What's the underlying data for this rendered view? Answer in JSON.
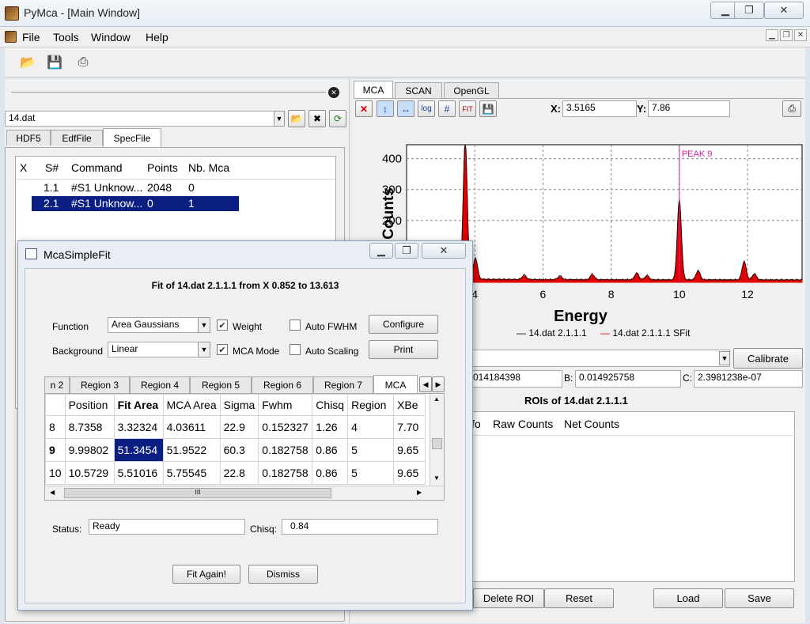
{
  "window": {
    "title": "PyMca - [Main Window]"
  },
  "menu": [
    "File",
    "Tools",
    "Window",
    "Help"
  ],
  "source": {
    "file": "14.dat",
    "tabs": [
      "HDF5",
      "EdfFile",
      "SpecFile"
    ],
    "columns": [
      "X",
      "S#",
      "Command",
      "Points",
      "Nb. Mca"
    ],
    "rows": [
      {
        "sn": "1.1",
        "command": "#S1 Unknow...",
        "points": "2048",
        "nbmca": "0"
      },
      {
        "sn": "2.1",
        "command": "#S1 Unknow...",
        "points": "0",
        "nbmca": "1"
      }
    ]
  },
  "plot": {
    "tabs": [
      "MCA",
      "SCAN",
      "OpenGL"
    ],
    "x_label_prefix": "X:",
    "x_value": "3.5165",
    "y_label_prefix": "Y:",
    "y_value": "7.86",
    "legend": [
      "— 14.dat 2.1.1.1",
      "— 14.dat 2.1.1.1 SFit"
    ],
    "colors": {
      "data": "#000000",
      "fit": "#e00000",
      "marker": "#d020a0"
    }
  },
  "chart_data": {
    "type": "line",
    "xlabel": "Energy",
    "ylabel": "Counts",
    "x_ticks": [
      4,
      6,
      8,
      10,
      12
    ],
    "y_ticks": [
      200,
      300,
      400
    ],
    "xlim": [
      2.0,
      13.6
    ],
    "ylim": [
      0,
      445
    ],
    "marker_label": "PEAK 9",
    "marker_x": 10.0,
    "series": [
      {
        "name": "14.dat 2.1.1.1",
        "peaks": [
          [
            3.5,
            60
          ],
          [
            3.72,
            445
          ],
          [
            4.02,
            70
          ],
          [
            5.45,
            15
          ],
          [
            6.5,
            12
          ],
          [
            7.45,
            18
          ],
          [
            8.75,
            22
          ],
          [
            9.05,
            14
          ],
          [
            10.0,
            260
          ],
          [
            10.55,
            30
          ],
          [
            11.9,
            60
          ],
          [
            12.2,
            20
          ]
        ]
      },
      {
        "name": "14.dat 2.1.1.1 SFit",
        "peaks": [
          [
            3.5,
            50
          ],
          [
            3.72,
            445
          ],
          [
            4.02,
            65
          ],
          [
            5.45,
            12
          ],
          [
            6.5,
            10
          ],
          [
            7.45,
            15
          ],
          [
            8.75,
            20
          ],
          [
            9.05,
            12
          ],
          [
            10.0,
            255
          ],
          [
            10.55,
            28
          ],
          [
            11.9,
            58
          ],
          [
            12.2,
            18
          ]
        ]
      }
    ]
  },
  "calib": {
    "button": "Calibrate",
    "a_value": "014184398",
    "b_label": "B:",
    "b_value": "0.014925758",
    "c_label": "C:",
    "c_value": "2.3981238e-07"
  },
  "roi": {
    "title": "ROIs of 14.dat 2.1.1.1",
    "columns_partial": "fo",
    "columns": [
      "Raw Counts",
      "Net Counts"
    ],
    "buttons": [
      "Delete ROI",
      "Reset",
      "Load",
      "Save"
    ]
  },
  "dialog": {
    "title": "McaSimpleFit",
    "fit_heading": "Fit of 14.dat 2.1.1.1 from X 0.852 to 13.613",
    "function_label": "Function",
    "function_value": "Area Gaussians",
    "background_label": "Background",
    "background_value": "Linear",
    "weight_label": "Weight",
    "mcamode_label": "MCA Mode",
    "autofwhm_label": "Auto FWHM",
    "autoscaling_label": "Auto Scaling",
    "configure": "Configure",
    "print": "Print",
    "region_tabs": [
      "n 2",
      "Region 3",
      "Region 4",
      "Region 5",
      "Region 6",
      "Region 7",
      "MCA"
    ],
    "table_headers": [
      "",
      "Position",
      "Fit Area",
      "MCA Area",
      "Sigma",
      "Fwhm",
      "Chisq",
      "Region",
      "XBe"
    ],
    "table_rows": [
      [
        "8",
        "8.7358",
        "3.32324",
        "4.03611",
        "22.9",
        "0.152327",
        "1.26",
        "4",
        "7.70"
      ],
      [
        "9",
        "9.99802",
        "51.3454",
        "51.9522",
        "60.3",
        "0.182758",
        "0.86",
        "5",
        "9.65"
      ],
      [
        "10",
        "10.5729",
        "5.51016",
        "5.75545",
        "22.8",
        "0.182758",
        "0.86",
        "5",
        "9.65"
      ]
    ],
    "scroll_mark": "III",
    "status_label": "Status:",
    "status_value": "Ready",
    "chisq_label": "Chisq:",
    "chisq_value": "0.84",
    "fit_again": "Fit Again!",
    "dismiss": "Dismiss"
  }
}
